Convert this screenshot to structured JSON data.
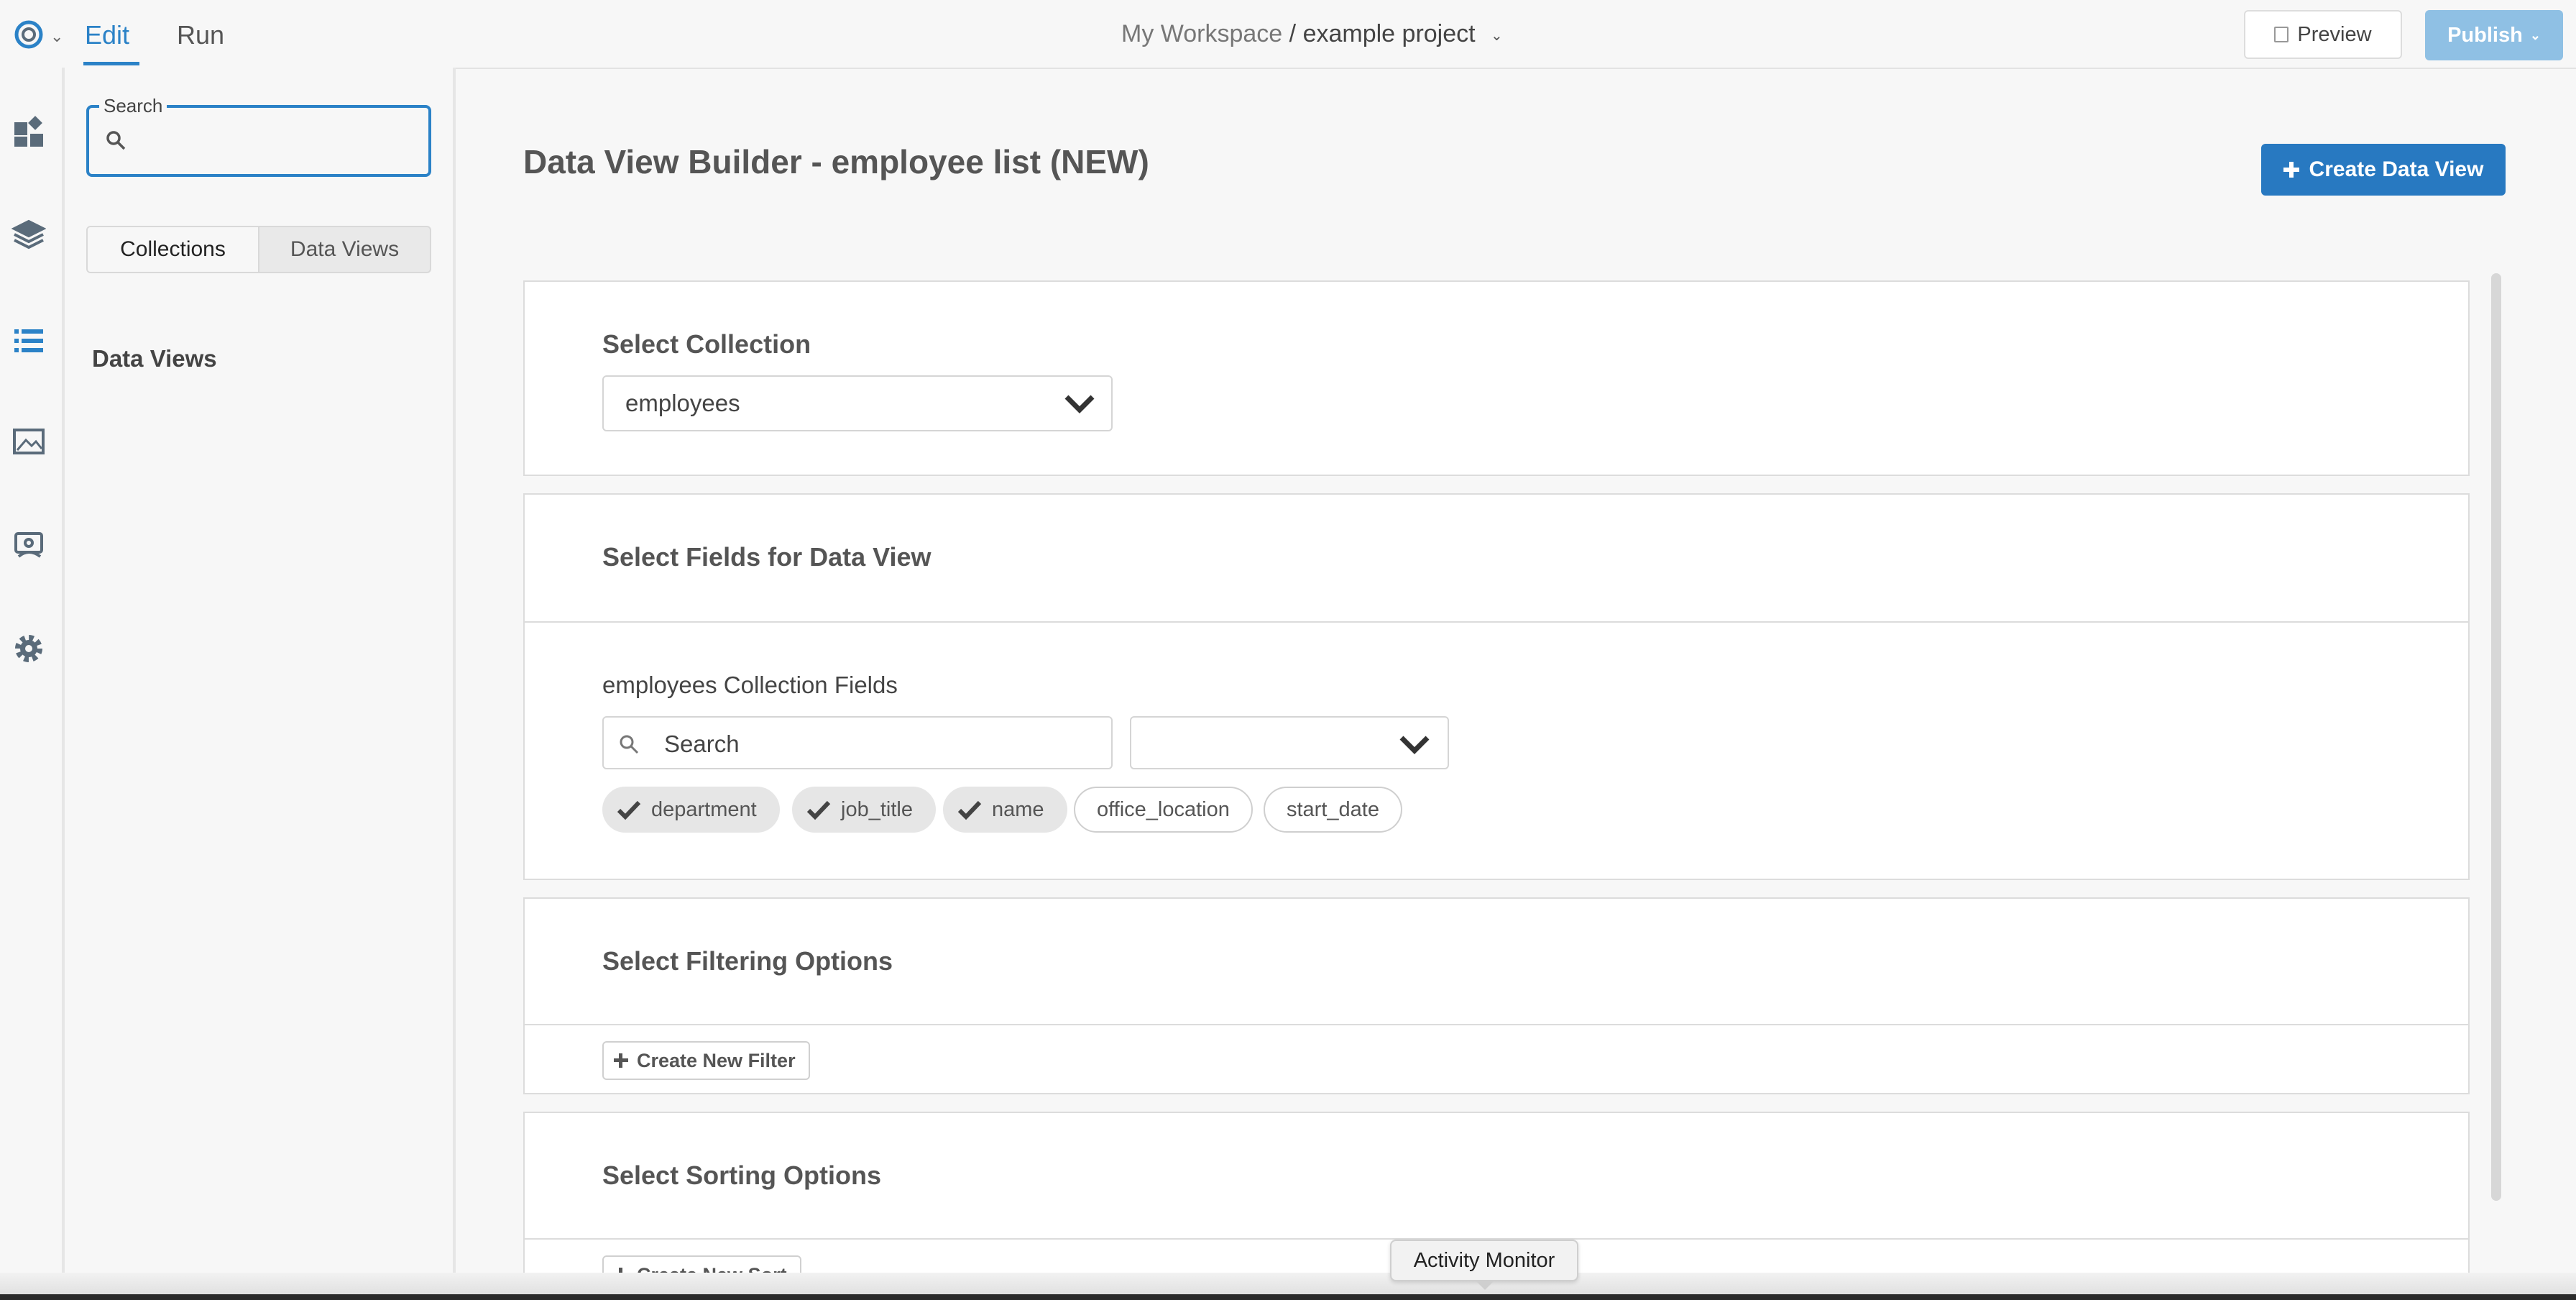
{
  "header": {
    "nav": {
      "edit_label": "Edit",
      "run_label": "Run"
    },
    "breadcrumb": {
      "workspace": "My Workspace",
      "separator": "/",
      "project": "example project"
    },
    "preview_label": "Preview",
    "publish_label": "Publish",
    "accent_color": "#2b82c7"
  },
  "rail": {
    "icons": [
      "dashboard-icon",
      "layers-icon",
      "list-icon",
      "image-icon",
      "devices-icon",
      "gear-icon"
    ]
  },
  "sidebar": {
    "search_legend": "Search",
    "search_value": "",
    "tabs": [
      {
        "label": "Collections",
        "active": true
      },
      {
        "label": "Data Views",
        "active": false
      }
    ],
    "heading": "Data Views"
  },
  "main": {
    "title": "Data View Builder - employee list (NEW)",
    "create_button_label": "Create Data View",
    "select_collection": {
      "title": "Select Collection",
      "selected_value": "employees"
    },
    "select_fields": {
      "title": "Select Fields for Data View",
      "fields_label": "employees Collection Fields",
      "search_placeholder": "Search",
      "filter_value": "",
      "chips": [
        {
          "label": "department",
          "selected": true
        },
        {
          "label": "job_title",
          "selected": true
        },
        {
          "label": "name",
          "selected": true
        },
        {
          "label": "office_location",
          "selected": false
        },
        {
          "label": "start_date",
          "selected": false
        }
      ]
    },
    "filtering": {
      "title": "Select Filtering Options",
      "button_label": "Create New Filter"
    },
    "sorting": {
      "title": "Select Sorting Options",
      "button_label": "Create New Sort"
    }
  },
  "tooltip": {
    "text": "Activity Monitor"
  }
}
